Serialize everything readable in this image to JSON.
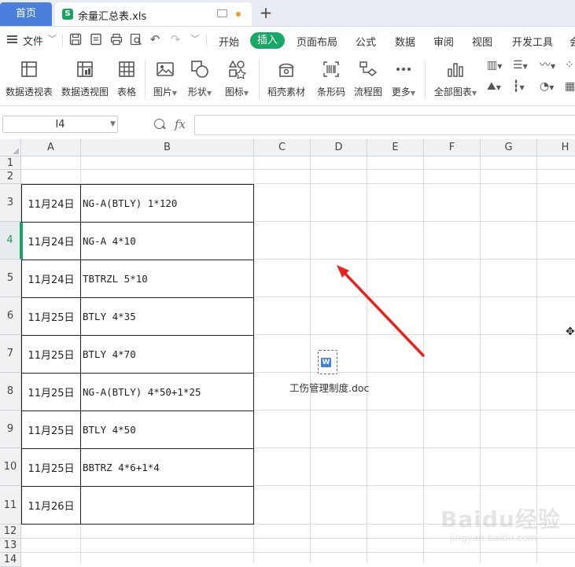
{
  "tabs": {
    "home_label": "首页",
    "file_name": "余量汇总表.xls",
    "file_icon_letter": "S"
  },
  "menu": {
    "file_label": "文件",
    "items": [
      "开始",
      "插入",
      "页面布局",
      "公式",
      "数据",
      "审阅",
      "视图",
      "开发工具",
      "会"
    ],
    "active_index": 1
  },
  "ribbon": {
    "buttons": [
      "数据透视表",
      "数据透视图",
      "表格",
      "图片",
      "形状",
      "图标",
      "稻壳素材",
      "条形码",
      "流程图",
      "更多",
      "全部图表"
    ]
  },
  "formula_bar": {
    "name_box": "I4",
    "fx_label": "fx",
    "formula_value": ""
  },
  "sheet": {
    "columns": [
      "A",
      "B",
      "C",
      "D",
      "E",
      "F",
      "G",
      "H"
    ],
    "rows": [
      "1",
      "2",
      "3",
      "4",
      "5",
      "6",
      "7",
      "8",
      "9",
      "10",
      "11",
      "12",
      "13",
      "14"
    ],
    "active_row": "4",
    "data": [
      {
        "row": "3",
        "a": "11月24日",
        "b": "NG-A(BTLY) 1*120"
      },
      {
        "row": "4",
        "a": "11月24日",
        "b": "NG-A 4*10"
      },
      {
        "row": "5",
        "a": "11月24日",
        "b": "TBTRZL 5*10"
      },
      {
        "row": "6",
        "a": "11月25日",
        "b": "BTLY 4*35"
      },
      {
        "row": "7",
        "a": "11月25日",
        "b": "BTLY 4*70"
      },
      {
        "row": "8",
        "a": "11月25日",
        "b": "NG-A(BTLY) 4*50+1*25"
      },
      {
        "row": "9",
        "a": "11月25日",
        "b": "BTLY 4*50"
      },
      {
        "row": "10",
        "a": "11月25日",
        "b": "BBTRZ 4*6+1*4"
      },
      {
        "row": "11",
        "a": "11月26日",
        "b": ""
      }
    ]
  },
  "embedded_object": {
    "file_name": "工伤管理制度.doc",
    "icon_letter": "W"
  },
  "annotation": {
    "arrow_color": "#e8231f"
  },
  "watermark": {
    "brand": "Baidu经验",
    "url": "jingyan.baidu.com"
  },
  "colors": {
    "accent_green": "#17a866",
    "home_tab_blue": "#4a7fdc",
    "grid_line": "#dadde1"
  }
}
